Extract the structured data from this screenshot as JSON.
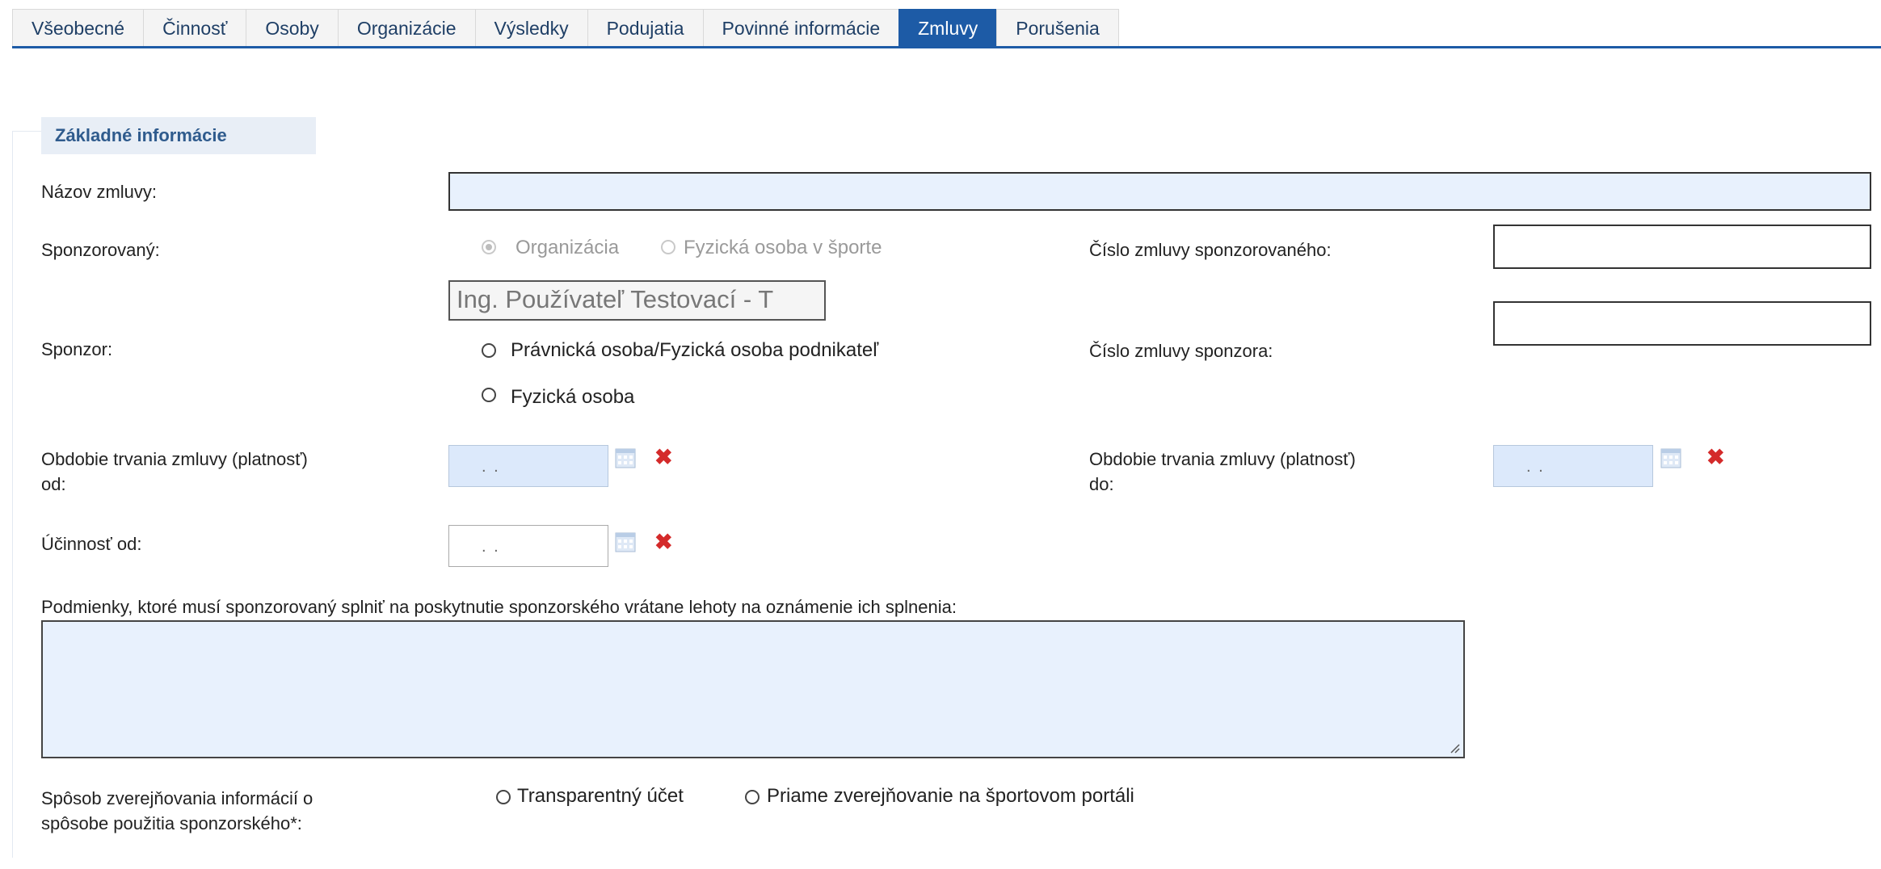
{
  "tabs": [
    {
      "label": "Všeobecné",
      "active": false
    },
    {
      "label": "Činnosť",
      "active": false
    },
    {
      "label": "Osoby",
      "active": false
    },
    {
      "label": "Organizácie",
      "active": false
    },
    {
      "label": "Výsledky",
      "active": false
    },
    {
      "label": "Podujatia",
      "active": false
    },
    {
      "label": "Povinné informácie",
      "active": false
    },
    {
      "label": "Zmluvy",
      "active": true
    },
    {
      "label": "Porušenia",
      "active": false
    }
  ],
  "section": {
    "legend": "Základné informácie"
  },
  "form": {
    "nazov_label": "Názov zmluvy:",
    "nazov_value": "",
    "sponzorovany_label": "Sponzorovaný:",
    "sponzorovany_options": [
      "Organizácia",
      "Fyzická osoba v športe"
    ],
    "sponzorovany_selected": "Organizácia",
    "sponzorovany_name": "Ing. Používateľ Testovací - T",
    "cislo_sponzorovaneho_label": "Číslo zmluvy sponzorovaného:",
    "cislo_sponzorovaneho_value": "",
    "sponzor_label": "Sponzor:",
    "sponzor_options": [
      "Právnická osoba/Fyzická osoba podnikateľ",
      "Fyzická osoba"
    ],
    "cislo_sponzora_label": "Číslo zmluvy sponzora:",
    "cislo_sponzora_value": "",
    "obdobie_od_label_1": "Obdobie trvania zmluvy (platnosť)",
    "obdobie_od_label_2": "od:",
    "obdobie_do_label_1": "Obdobie trvania zmluvy (platnosť)",
    "obdobie_do_label_2": "do:",
    "date_mask": ". .",
    "ucinnost_label": "Účinnosť od:",
    "podmienky_label": "Podmienky, ktoré musí sponzorovaný splniť na poskytnutie sponzorského vrátane lehoty na oznámenie ich splnenia:",
    "podmienky_value": "",
    "sposob_label_1": "Spôsob zverejňovania informácií o",
    "sposob_label_2": "spôsobe použitia sponzorského*:",
    "sposob_options": [
      "Transparentný účet",
      "Priame zverejňovanie na športovom portáli"
    ]
  },
  "icons": {
    "calendar": "calendar-icon",
    "delete": "delete-x-icon",
    "resize": "resize-grip-icon"
  },
  "colors": {
    "accent": "#1d5ba6",
    "input_bg": "#e8f1fd",
    "delete": "#d42a2a"
  }
}
